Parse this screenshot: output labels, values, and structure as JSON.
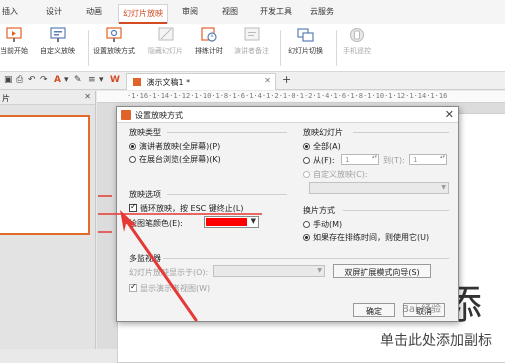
{
  "ribbon": {
    "tabs": [
      {
        "label": "插入"
      },
      {
        "label": "设计"
      },
      {
        "label": "动画"
      },
      {
        "label": "幻灯片放映",
        "active": true
      },
      {
        "label": "审阅"
      },
      {
        "label": "视图"
      },
      {
        "label": "开发工具"
      },
      {
        "label": "云服务"
      }
    ],
    "buttons": [
      {
        "label": "当前开始",
        "icon": "play-from-current-icon",
        "enabled": true
      },
      {
        "label": "自定义放映",
        "icon": "custom-show-icon",
        "enabled": true
      },
      {
        "label": "设置放映方式",
        "icon": "setup-show-icon",
        "enabled": true
      },
      {
        "label": "隐藏幻灯片",
        "icon": "hide-slide-icon",
        "enabled": false
      },
      {
        "label": "排练计时",
        "icon": "rehearse-timing-icon",
        "enabled": true
      },
      {
        "label": "演讲者备注",
        "icon": "speaker-notes-icon",
        "enabled": false
      },
      {
        "label": "幻灯片切换",
        "icon": "slide-transition-icon",
        "enabled": true
      },
      {
        "label": "手机遥控",
        "icon": "phone-remote-icon",
        "enabled": false
      }
    ]
  },
  "document": {
    "tab_title": "演示文稿1 *",
    "left_pane_header": "片",
    "slide_text_large": "添",
    "slide_text_small": "单击此处添加副标"
  },
  "dialog": {
    "title": "设置放映方式",
    "show_type": {
      "label": "放映类型",
      "options": [
        "演讲者放映(全屏幕)(P)",
        "在展台浏览(全屏幕)(K)"
      ],
      "selected": 0
    },
    "show_slides": {
      "label": "放映幻灯片",
      "all": "全部(A)",
      "from": "从(F):",
      "from_value": "1",
      "to": "到(T):",
      "to_value": "1",
      "custom": "自定义放映(C):",
      "selected": "all"
    },
    "show_options": {
      "label": "放映选项",
      "loop": "循环放映，按 ESC 键终止(L)",
      "loop_checked": true,
      "pen_color_label": "绘图笔颜色(E):",
      "pen_color": "#ff0000"
    },
    "advance": {
      "label": "换片方式",
      "manual": "手动(M)",
      "timings": "如果存在排练时间，则使用它(U)",
      "selected": "timings"
    },
    "multi_monitor": {
      "label": "多监视器",
      "display_label": "幻灯片放映显示于(O):",
      "presenter_view": "显示演示者视图(W)",
      "presenter_checked": true,
      "wizard_button": "双屏扩展模式向导(S)"
    },
    "ok": "确定",
    "cancel": "取消"
  },
  "watermark": "Bai 经验",
  "colors": {
    "accent": "#d24b22",
    "annotation": "#e53935"
  }
}
